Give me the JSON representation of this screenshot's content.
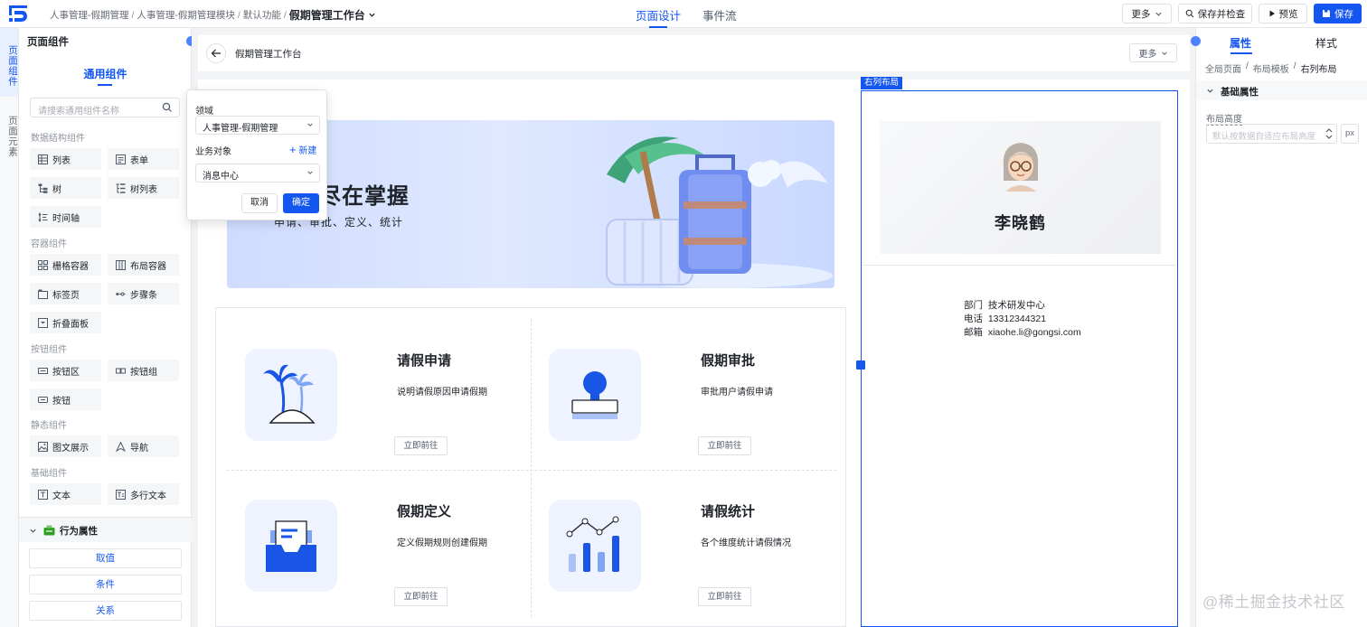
{
  "topbar": {
    "breadcrumb": [
      "人事管理-假期管理",
      "人事管理-假期管理模块",
      "默认功能"
    ],
    "current_page": "假期管理工作台",
    "tabs": [
      {
        "label": "页面设计",
        "active": true
      },
      {
        "label": "事件流",
        "active": false
      }
    ],
    "more_label": "更多",
    "save_check_label": "保存并检查",
    "preview_label": "预览",
    "save_label": "保存"
  },
  "rail": {
    "components_label": "页面组件",
    "elements_label": "页面元素"
  },
  "left_panel": {
    "title": "页面组件",
    "tab": "通用组件",
    "search_placeholder": "请搜索通用组件名称",
    "groups": [
      {
        "name": "数据结构组件",
        "items": [
          "列表",
          "表单",
          "树",
          "树列表",
          "时间轴"
        ]
      },
      {
        "name": "容器组件",
        "items": [
          "栅格容器",
          "布局容器",
          "标签页",
          "步骤条",
          "折叠面板"
        ]
      },
      {
        "name": "按钮组件",
        "items": [
          "按钮区",
          "按钮组",
          "按钮"
        ]
      },
      {
        "name": "静态组件",
        "items": [
          "图文展示",
          "导航"
        ]
      },
      {
        "name": "基础组件",
        "items": [
          "文本",
          "多行文本"
        ]
      }
    ],
    "behavior_title": "行为属性",
    "behavior_buttons": [
      "取值",
      "条件",
      "关系"
    ]
  },
  "canvas": {
    "page_title": "假期管理工作台",
    "more_label": "更多",
    "banner_title": "管理尽在掌握",
    "banner_subtitle": "申请、审批、定义、统计",
    "cards": [
      {
        "title": "请假申请",
        "desc": "说明请假原因申请假期",
        "button": "立即前往",
        "icon": "palm-tree-icon"
      },
      {
        "title": "假期审批",
        "desc": "审批用户请假申请",
        "button": "立即前往",
        "icon": "stamp-icon"
      },
      {
        "title": "假期定义",
        "desc": "定义假期规则创建假期",
        "button": "立即前往",
        "icon": "inbox-document-icon"
      },
      {
        "title": "请假统计",
        "desc": "各个维度统计请假情况",
        "button": "立即前往",
        "icon": "bar-chart-icon"
      }
    ],
    "right_column_tag": "右列布局",
    "profile": {
      "name": "李晓鹤",
      "department_label": "部门",
      "department": "技术研发中心",
      "phone_label": "电话",
      "phone": "13312344321",
      "email_label": "邮箱",
      "email": "xiaohe.li@gongsi.com"
    }
  },
  "popover": {
    "domain_label": "领域",
    "domain_value": "人事管理-假期管理",
    "object_label": "业务对象",
    "new_label": "新建",
    "object_value": "消息中心",
    "cancel_label": "取消",
    "ok_label": "确定"
  },
  "right_panel": {
    "tabs": [
      {
        "label": "属性",
        "active": true
      },
      {
        "label": "样式",
        "active": false
      }
    ],
    "breadcrumb": [
      "全局页面",
      "布局模板",
      "右列布局"
    ],
    "section": "基础属性",
    "height_label": "布局高度",
    "height_placeholder": "默认按数据自适应布局高度",
    "unit": "px"
  },
  "watermark": "@稀土掘金技术社区",
  "colors": {
    "primary": "#1456f0",
    "border": "#dee0e3",
    "canvas_bg": "#f2f3f5"
  }
}
